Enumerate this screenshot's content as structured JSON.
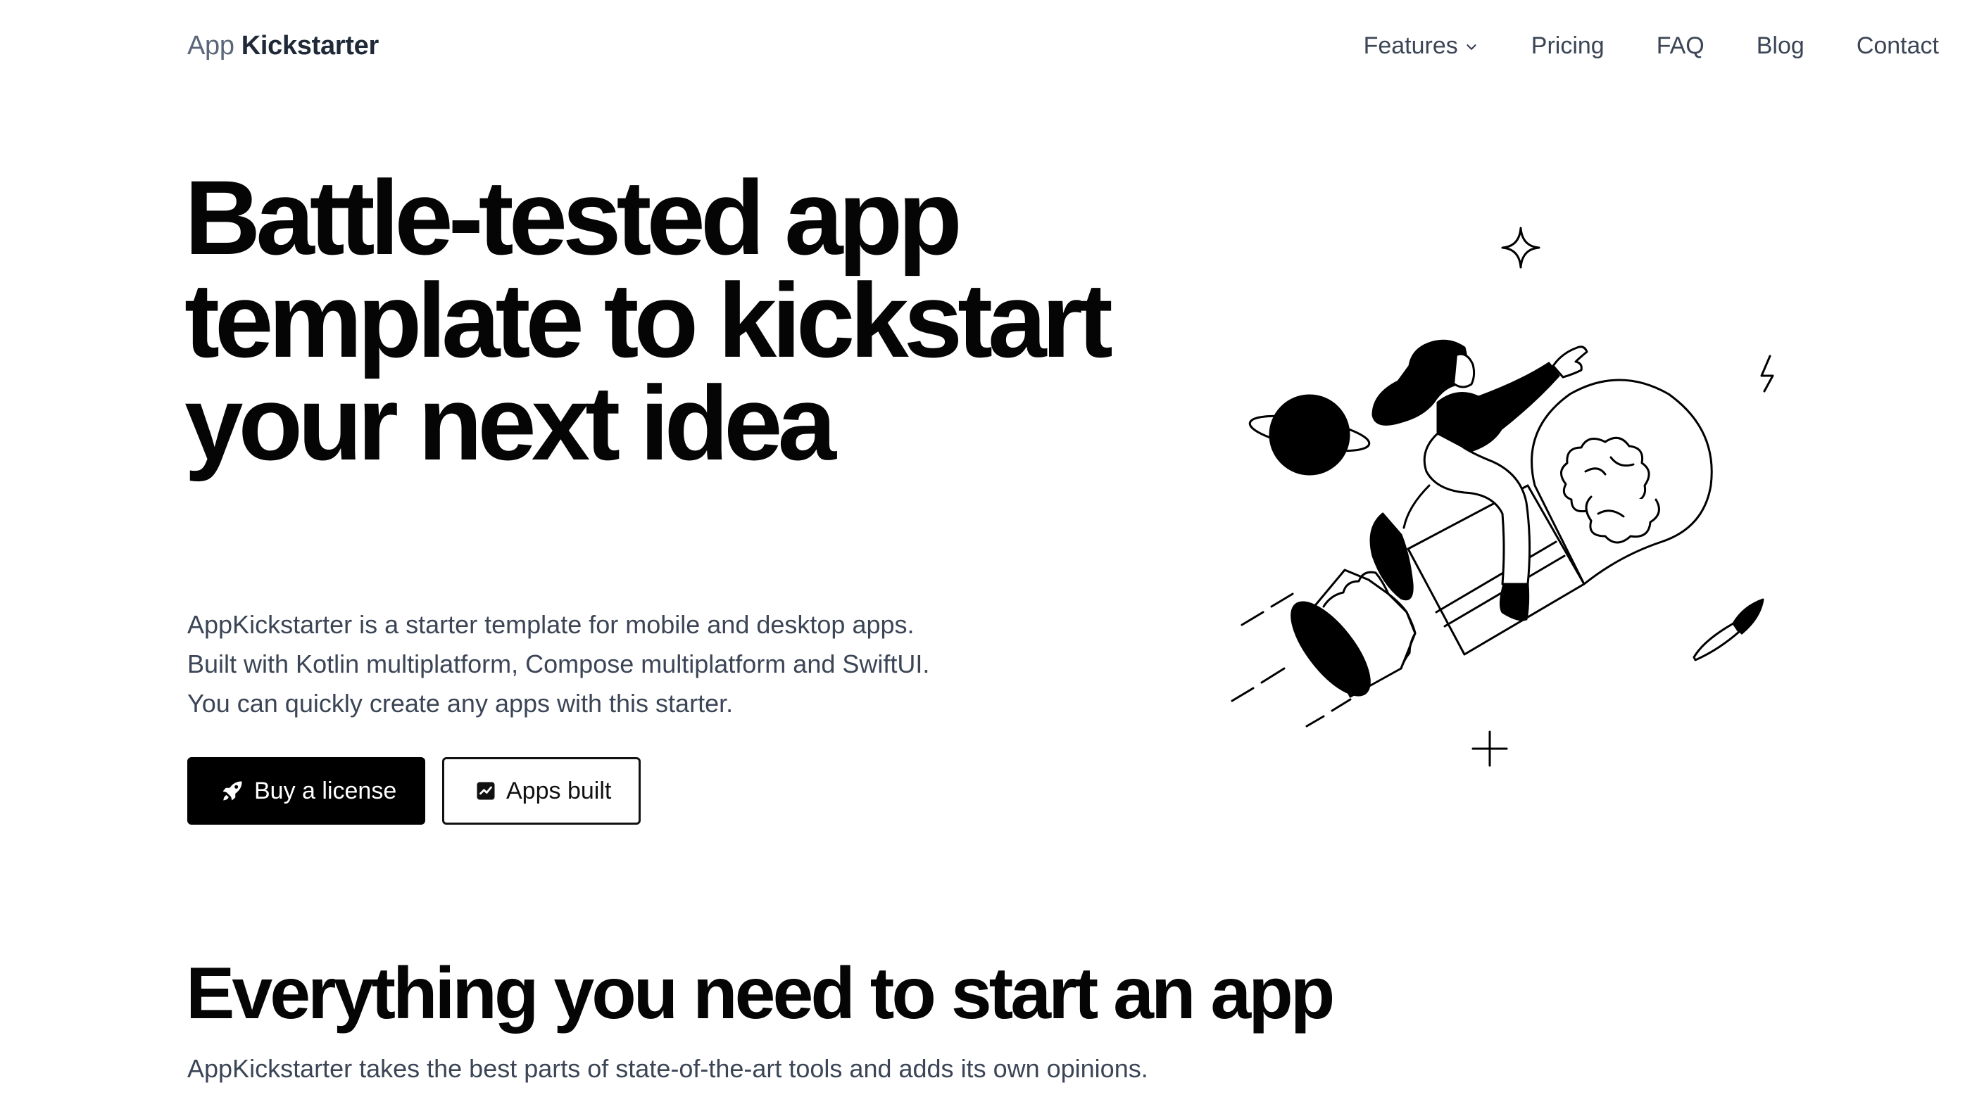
{
  "nav": {
    "brand_light": "App",
    "brand_bold": "Kickstarter",
    "links": [
      {
        "label": "Features"
      },
      {
        "label": "Pricing"
      },
      {
        "label": "FAQ"
      },
      {
        "label": "Blog"
      },
      {
        "label": "Contact"
      }
    ]
  },
  "hero": {
    "title": "Battle-tested app template to kickstart your next idea",
    "description_lines": [
      "AppKickstarter is a starter template for mobile and desktop apps.",
      "Built with Kotlin multiplatform, Compose multiplatform and SwiftUI.",
      "You can quickly create any apps with this starter."
    ],
    "primary_button": {
      "label": "Buy a license",
      "icon": "rocket-icon"
    },
    "secondary_button": {
      "label": "Apps built",
      "icon": "chart-icon"
    },
    "illustration": "woman-riding-lightbulb-rocket"
  },
  "features_section": {
    "title": "Everything you need to start an app",
    "description": "AppKickstarter takes the best parts of state-of-the-art tools and adds its own opinions."
  },
  "colors": {
    "text_primary": "#050505",
    "text_muted": "#3b4556",
    "brand_light": "#5b6678",
    "button_bg": "#000000",
    "page_bg": "#ffffff"
  }
}
